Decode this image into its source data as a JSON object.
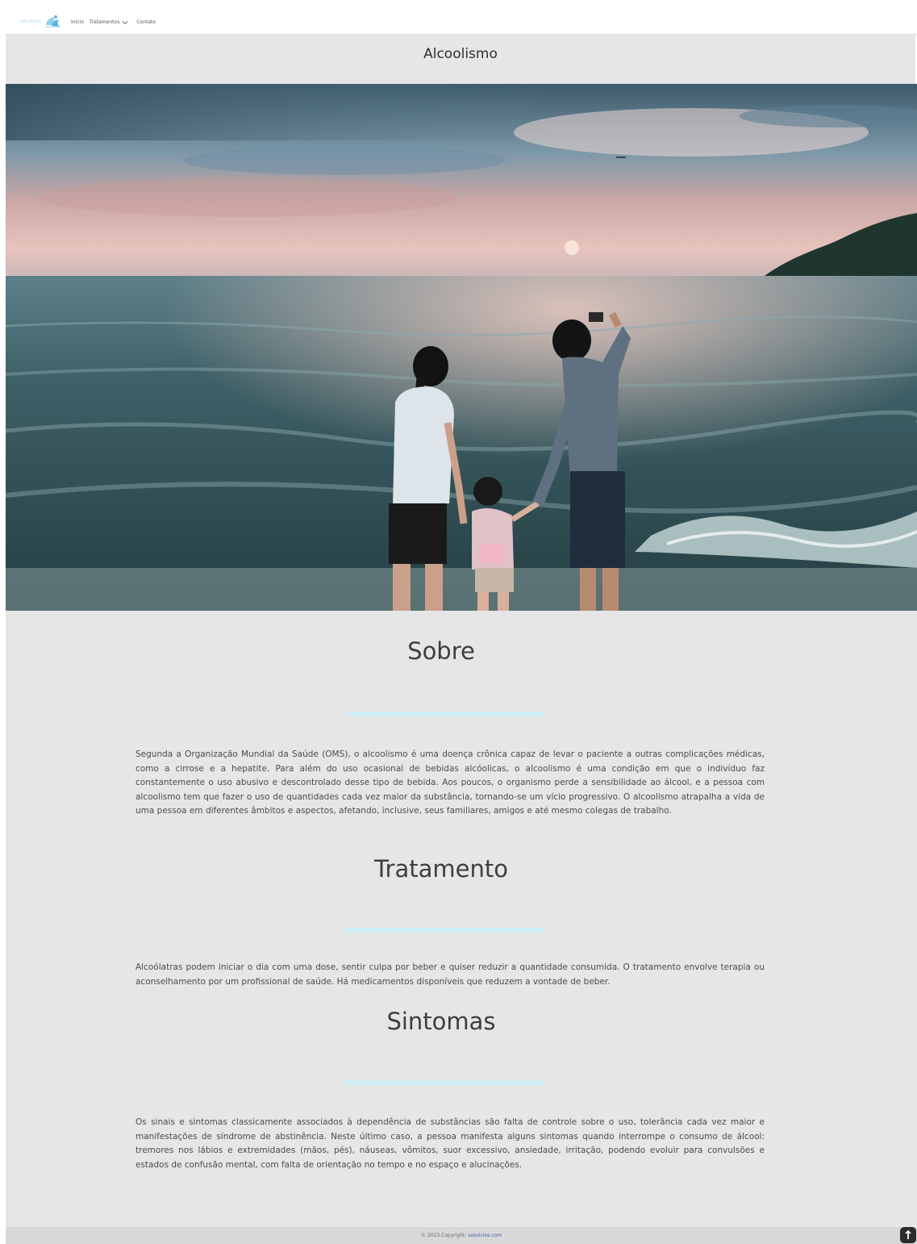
{
  "nav": {
    "brand_text": "SOS VÍCIOS",
    "brand_logo_icon": "brand-logo-icon",
    "links": {
      "inicio": "Início",
      "tratamentos": "Tratamentos",
      "contato": "Contato"
    }
  },
  "page_title": "Alcoolismo",
  "hero": {
    "image_icon": "family-beach-photo"
  },
  "sections": {
    "sobre": {
      "heading": "Sobre",
      "text": "Segunda a Organização Mundial da Saúde (OMS), o alcoolismo é uma doença crônica capaz de levar o paciente a outras complicações médicas, como a cirrose e a hepatite. Para além do uso ocasional de bebidas alcóolicas, o alcoolismo é uma condição em que o indivíduo faz constantemente o uso abusivo e descontrolado desse tipo de bebida. Aos poucos, o organismo perde a sensibilidade ao álcool, e a pessoa com alcoolismo tem que fazer o uso de quantidades cada vez maior da substância, tornando-se um vício progressivo. O alcoolismo atrapalha a vida de uma pessoa em diferentes âmbitos e aspectos, afetando, inclusive, seus familiares, amigos e até mesmo colegas de trabalho."
    },
    "tratamento": {
      "heading": "Tratamento",
      "text": "Alcoólatras podem iniciar o dia com uma dose, sentir culpa por beber e quiser reduzir a quantidade consumida. O tratamento envolve terapia ou aconselhamento por um profissional de saúde. Há medicamentos disponíveis que reduzem a vontade de beber."
    },
    "sintomas": {
      "heading": "Sintomas",
      "text": "Os sinais e sintomas classicamente associados à dependência de substâncias são falta de controle sobre o uso, tolerância cada vez maior e manifestações de síndrome de abstinência. Neste último caso, a pessoa manifesta alguns sintomas quando interrompe o consumo de álcool: tremores nos lábios e extremidades (mãos, pés), náuseas, vômitos, suor excessivo, ansiedade, irritação, podendo evoluir para convulsões e estados de confusão mental, com falta de orientação no tempo e no espaço e alucinações."
    }
  },
  "footer": {
    "copyright": "© 2023 Copyright:",
    "link": "sosvicios.com"
  },
  "colors": {
    "page_bg": "#e6e6e6",
    "divider": "#cdeef7",
    "link": "#3b5ea8"
  }
}
